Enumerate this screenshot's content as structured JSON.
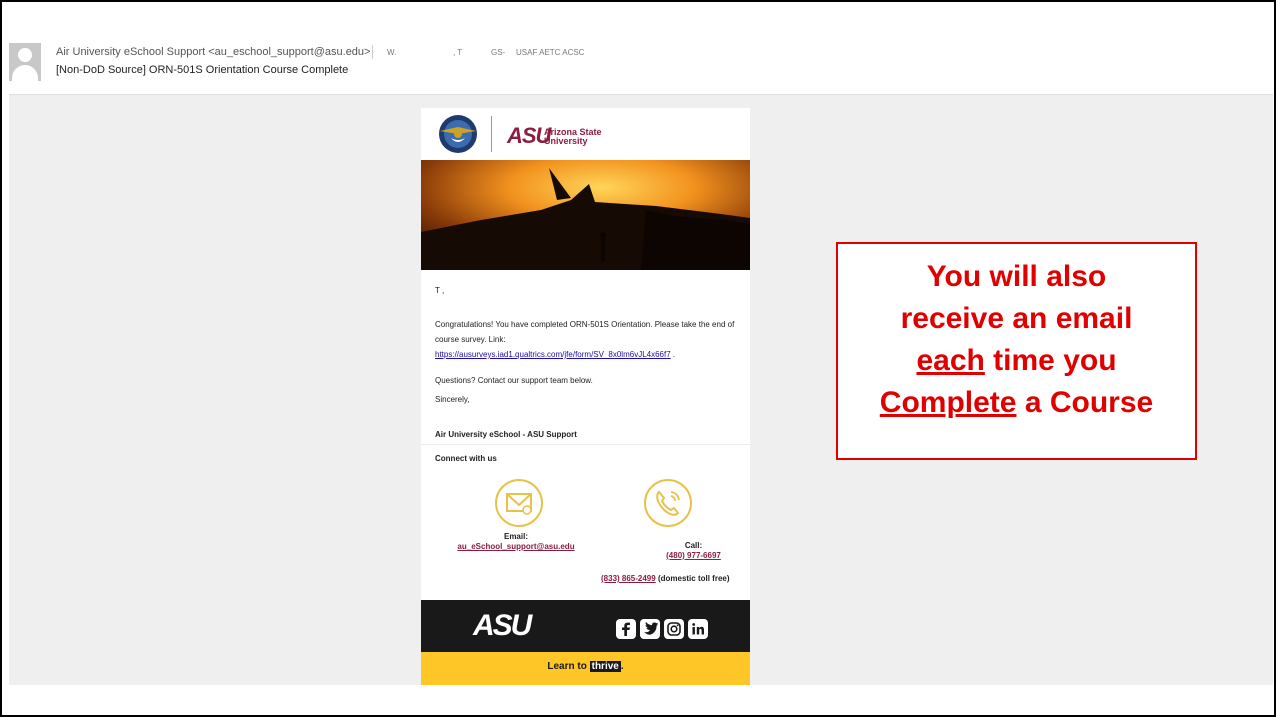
{
  "email": {
    "sender": "Air University eSchool Support <au_eschool_support@asu.edu>",
    "recipient_w": "W.",
    "recipient_t": ", T",
    "recipient_gs": "GS-",
    "recipient_org": "USAF AETC ACSC",
    "subject": "[Non-DoD Source] ORN-501S Orientation Course Complete"
  },
  "card": {
    "asu_logo_text": "ASU",
    "asu_name_line1": "Arizona State",
    "asu_name_line2": "University",
    "greeting": "T        ,",
    "body_line1": "Congratulations! You have completed ORN-501S Orientation. Please take the end of course survey. Link:",
    "survey_link": "https://ausurveys.iad1.qualtrics.com/jfe/form/SV_8x0lm6vJL4x66f7",
    "body_suffix": " .",
    "questions": "Questions? Contact our support team below.",
    "sincerely": "Sincerely,",
    "signature": "Air University eSchool - ASU Support",
    "connect_heading": "Connect with us",
    "email_label": "Email:",
    "email_address": "au_eSchool_support@asu.edu",
    "call_label": "Call:",
    "phone_primary": "(480) 977-6697",
    "phone_tollfree": "(833) 865-2499",
    "tollfree_suffix": " (domestic toll free)",
    "footer_logo": "ASU",
    "tagline_prefix": "Learn to ",
    "tagline_thrive": "thrive",
    "tagline_suffix": "."
  },
  "callout": {
    "line1": "You will also",
    "line2": "receive an email",
    "line3_u": "each",
    "line3_rest": " time you",
    "line4_u": "Complete",
    "line4_rest": " a Course",
    "color": "#e00000"
  },
  "colors": {
    "asu_maroon": "#8c1d40",
    "asu_gold": "#ffc627",
    "footer_black": "#191919"
  },
  "icons": {
    "avatar": "person-avatar-icon",
    "seal": "air-university-seal-icon",
    "email": "envelope-icon",
    "phone": "phone-icon",
    "facebook": "facebook-icon",
    "twitter": "twitter-icon",
    "instagram": "instagram-icon",
    "linkedin": "linkedin-icon"
  }
}
